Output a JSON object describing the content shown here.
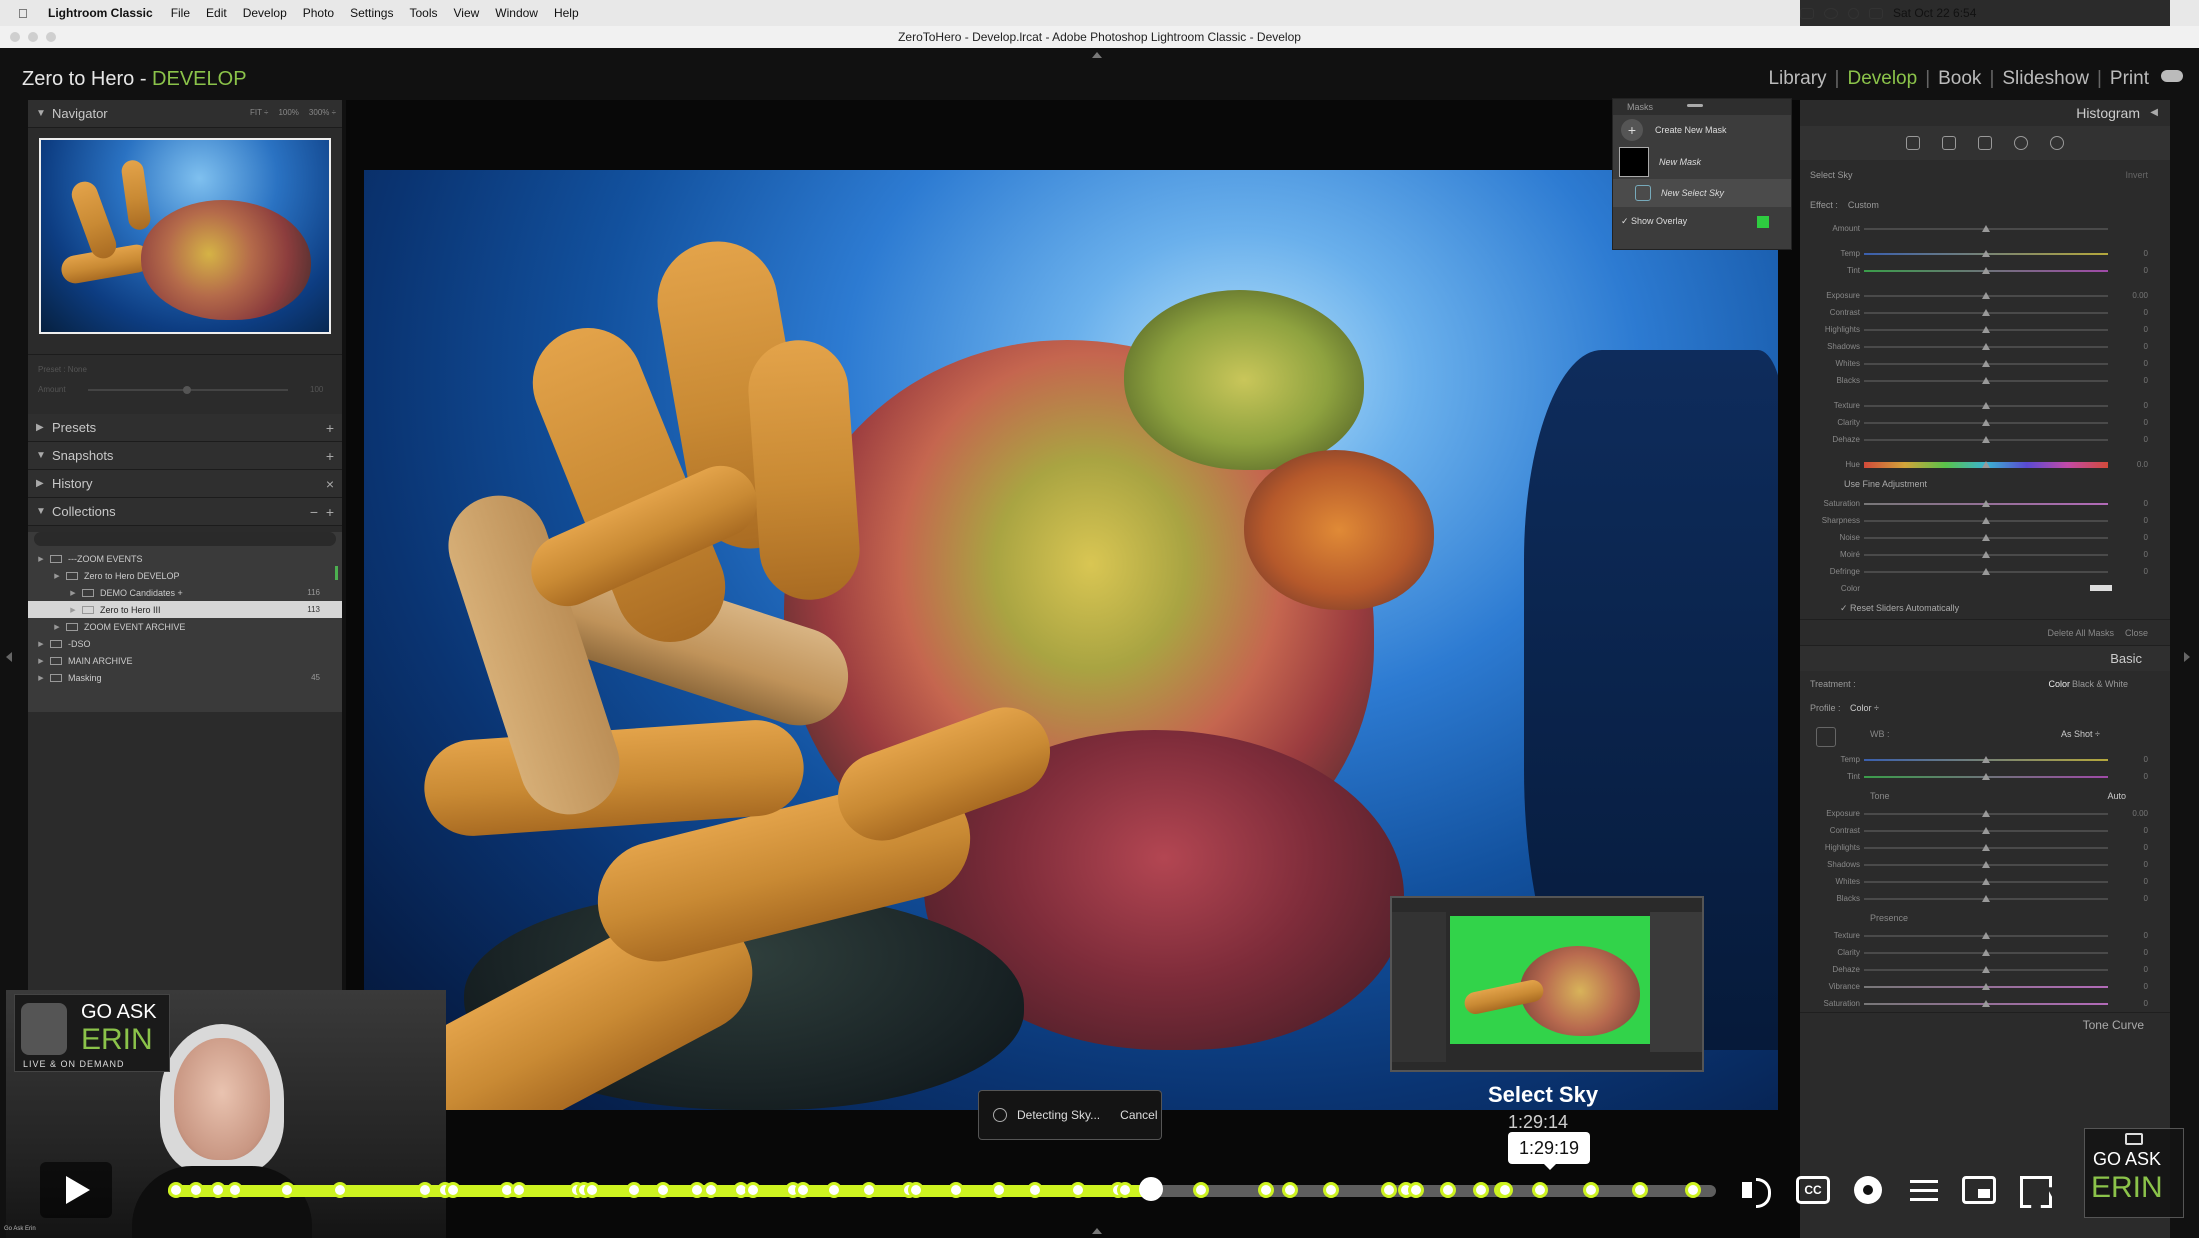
{
  "menubar": {
    "app": "Lightroom Classic",
    "items": [
      "File",
      "Edit",
      "Develop",
      "Photo",
      "Settings",
      "Tools",
      "View",
      "Window",
      "Help"
    ],
    "clock": "Sat Oct 22  6:54"
  },
  "window": {
    "title": "ZeroToHero - Develop.lrcat - Adobe Photoshop Lightroom Classic - Develop"
  },
  "identity": {
    "name": "Zero to Hero - ",
    "module": "DEVELOP"
  },
  "modules": [
    "Library",
    "Develop",
    "Book",
    "Slideshow",
    "Print"
  ],
  "left_panel": {
    "navigator": {
      "title": "Navigator",
      "zoom": [
        "FIT ÷",
        "100%",
        "300% ÷"
      ]
    },
    "preset_amount": {
      "preset": "Preset : None",
      "amount": "Amount",
      "value": "100"
    },
    "sections": [
      {
        "label": "Presets",
        "expanded": false
      },
      {
        "label": "Snapshots",
        "expanded": true
      },
      {
        "label": "History",
        "expanded": false
      },
      {
        "label": "Collections",
        "expanded": true
      }
    ],
    "collections": [
      {
        "label": "---ZOOM EVENTS",
        "depth": 1,
        "count": ""
      },
      {
        "label": "Zero to Hero DEVELOP",
        "depth": 2,
        "count": ""
      },
      {
        "label": "DEMO Candidates +",
        "depth": 3,
        "count": "116"
      },
      {
        "label": "Zero to Hero III",
        "depth": 3,
        "count": "113",
        "selected": true
      },
      {
        "label": "ZOOM EVENT ARCHIVE",
        "depth": 2,
        "count": ""
      },
      {
        "label": "-DSO",
        "depth": 1,
        "count": ""
      },
      {
        "label": "MAIN ARCHIVE",
        "depth": 1,
        "count": ""
      },
      {
        "label": "Masking",
        "depth": 1,
        "count": "45"
      }
    ]
  },
  "masks_panel": {
    "title": "Masks",
    "create": "Create New Mask",
    "mask_name": "New Mask",
    "sub_name": "New Select Sky",
    "overlay": "Show Overlay",
    "overlay_color": "#2ecc40"
  },
  "detecting": {
    "label": "Detecting Sky...",
    "cancel": "Cancel"
  },
  "right_panel": {
    "histogram": "Histogram",
    "mask_type": "Select Sky",
    "invert": "Invert",
    "effect_label": "Effect :",
    "effect_value": "Custom",
    "mask_sliders": [
      {
        "name": "Amount",
        "value": ""
      },
      {
        "name": "Temp",
        "value": "0"
      },
      {
        "name": "Tint",
        "value": "0"
      },
      {
        "name": "Exposure",
        "value": "0.00"
      },
      {
        "name": "Contrast",
        "value": "0"
      },
      {
        "name": "Highlights",
        "value": "0"
      },
      {
        "name": "Shadows",
        "value": "0"
      },
      {
        "name": "Whites",
        "value": "0"
      },
      {
        "name": "Blacks",
        "value": "0"
      },
      {
        "name": "Texture",
        "value": "0"
      },
      {
        "name": "Clarity",
        "value": "0"
      },
      {
        "name": "Dehaze",
        "value": "0"
      },
      {
        "name": "Hue",
        "value": "0.0"
      }
    ],
    "fine_adjust": "Use Fine Adjustment",
    "mask_sliders2": [
      {
        "name": "Saturation",
        "value": "0"
      },
      {
        "name": "Sharpness",
        "value": "0"
      },
      {
        "name": "Noise",
        "value": "0"
      },
      {
        "name": "Moiré",
        "value": "0"
      },
      {
        "name": "Defringe",
        "value": "0"
      },
      {
        "name": "Color",
        "value": ""
      }
    ],
    "reset_auto": "Reset Sliders Automatically",
    "delete_all": "Delete All Masks",
    "close": "Close",
    "basic": "Basic",
    "treatment": "Treatment :",
    "treat_color": "Color",
    "treat_bw": "Black & White",
    "profile_label": "Profile :",
    "profile_value": "Color ÷",
    "wb_label": "WB :",
    "wb_value": "As Shot ÷",
    "wb_sliders": [
      {
        "name": "Temp",
        "value": "0"
      },
      {
        "name": "Tint",
        "value": "0"
      }
    ],
    "tone_label": "Tone",
    "tone_auto": "Auto",
    "tone_sliders": [
      {
        "name": "Exposure",
        "value": "0.00"
      },
      {
        "name": "Contrast",
        "value": "0"
      },
      {
        "name": "Highlights",
        "value": "0"
      },
      {
        "name": "Shadows",
        "value": "0"
      },
      {
        "name": "Whites",
        "value": "0"
      },
      {
        "name": "Blacks",
        "value": "0"
      }
    ],
    "presence_label": "Presence",
    "presence_sliders": [
      {
        "name": "Texture",
        "value": "0"
      },
      {
        "name": "Clarity",
        "value": "0"
      },
      {
        "name": "Dehaze",
        "value": "0"
      },
      {
        "name": "Vibrance",
        "value": "0"
      },
      {
        "name": "Saturation",
        "value": "0"
      }
    ],
    "tone_curve": "Tone Curve"
  },
  "webcam": {
    "brand_go": "GO ASK",
    "brand_erin": "ERIN",
    "brand_sub": "LIVE & ON DEMAND",
    "watermark": "Go Ask Erin"
  },
  "player": {
    "chapter": "Select Sky",
    "chapter_time_under": "1:29:14",
    "hover_time": "1:29:19",
    "progress": 0.635,
    "chapter_marks": [
      0.005,
      0.018,
      0.032,
      0.043,
      0.077,
      0.111,
      0.166,
      0.179,
      0.184,
      0.219,
      0.227,
      0.264,
      0.269,
      0.274,
      0.301,
      0.32,
      0.342,
      0.351,
      0.37,
      0.378,
      0.404,
      0.41,
      0.43,
      0.453,
      0.479,
      0.483,
      0.509,
      0.537,
      0.56,
      0.588,
      0.614,
      0.618,
      0.667,
      0.709,
      0.725,
      0.751,
      0.789,
      0.8,
      0.806,
      0.827,
      0.848,
      0.862,
      0.864,
      0.886,
      0.919,
      0.951,
      0.985
    ],
    "accent": "#cdf320",
    "cc": "CC",
    "corner_go": "GO ASK",
    "corner_erin": "ERIN"
  }
}
